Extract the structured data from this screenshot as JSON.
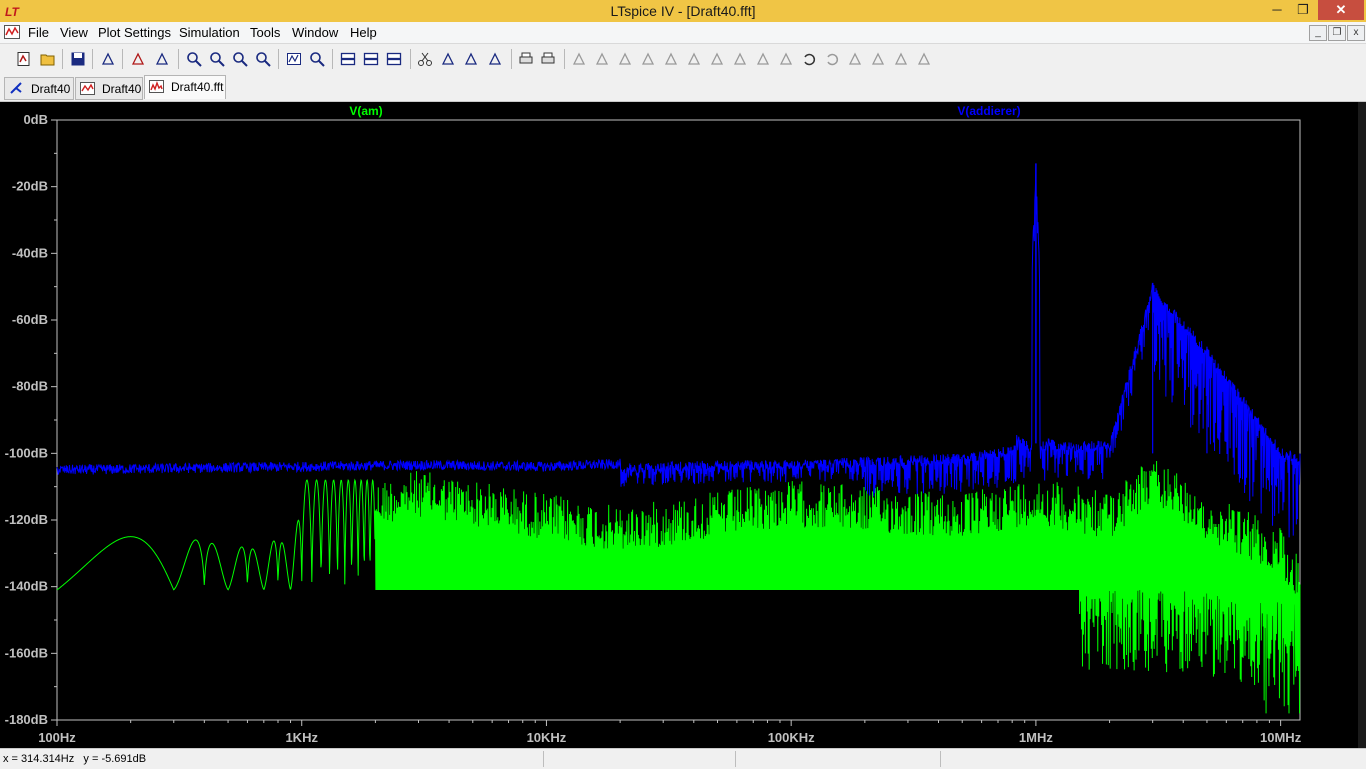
{
  "window": {
    "title": "LTspice IV - [Draft40.fft]",
    "min_glyph": "─",
    "max_glyph": "❐",
    "close_glyph": "✕"
  },
  "menu": {
    "items": [
      "File",
      "View",
      "Plot Settings",
      "Simulation",
      "Tools",
      "Window",
      "Help"
    ],
    "mdi_min_glyph": "_",
    "mdi_restore_glyph": "❐",
    "mdi_close_glyph": "x"
  },
  "toolbar": {
    "icons": [
      "new-schematic-icon",
      "open-icon",
      "save-icon",
      "control-panel-icon",
      "run-icon",
      "pan-icon",
      "zoom-in-icon",
      "zoom-area-icon",
      "zoom-out-icon",
      "zoom-cancel-icon",
      "autorange-icon",
      "zoom-fit-icon",
      "tile-horizontal-icon",
      "cascade-icon",
      "tile-vertical-icon",
      "cut-icon",
      "copy-icon",
      "paste-icon",
      "find-icon",
      "print-setup-icon",
      "print-icon",
      "wire-icon",
      "ground-icon",
      "label-net-icon",
      "resistor-icon",
      "capacitor-icon",
      "inductor-icon",
      "diode-icon",
      "component-icon",
      "move-icon",
      "drag-icon",
      "undo-icon",
      "redo-icon",
      "rotate-icon",
      "mirror-icon",
      "text-icon",
      "spice-directive-icon"
    ]
  },
  "tabs": [
    {
      "label": "Draft40",
      "icon": "schematic-icon",
      "active": false
    },
    {
      "label": "Draft40",
      "icon": "waveform-icon",
      "active": false
    },
    {
      "label": "Draft40.fft",
      "icon": "fft-icon",
      "active": true
    }
  ],
  "status": {
    "text": "x = 314.314Hz   y = -5.691dB"
  },
  "colors": {
    "green_trace": "#00ff00",
    "blue_trace": "#0000ff",
    "axis": "#c0c0c0",
    "background": "#000000"
  },
  "chart_data": {
    "type": "line",
    "title": "",
    "xlabel": "",
    "ylabel": "",
    "x_scale": "log",
    "xlim": [
      100,
      12000000
    ],
    "ylim": [
      -180,
      0
    ],
    "grid": false,
    "legend": "top",
    "x_tick_labels": [
      "100Hz",
      "1KHz",
      "10KHz",
      "100KHz",
      "1MHz",
      "10MHz"
    ],
    "x_tick_values": [
      100,
      1000,
      10000,
      100000,
      1000000,
      10000000
    ],
    "y_tick_labels": [
      "0dB",
      "-20dB",
      "-40dB",
      "-60dB",
      "-80dB",
      "-100dB",
      "-120dB",
      "-140dB",
      "-160dB",
      "-180dB"
    ],
    "y_tick_values": [
      0,
      -20,
      -40,
      -60,
      -80,
      -100,
      -120,
      -140,
      -160,
      -180
    ],
    "series": [
      {
        "name": "V(am)",
        "color": "#00ff00",
        "x": [
          100,
          200,
          300,
          400,
          500,
          600,
          700,
          800,
          900,
          1000,
          2000,
          3000,
          20000,
          100000,
          500000,
          1000000,
          2000000,
          3000000,
          5000000,
          10000000,
          12000000
        ],
        "y": [
          -141,
          -125,
          -140,
          -118,
          -140,
          -121,
          -140,
          -118,
          -140,
          -108,
          -108,
          -105,
          -116,
          -108,
          -112,
          -107,
          -112,
          -101,
          -112,
          -122,
          -132
        ]
      },
      {
        "name": "V(addierer)",
        "color": "#0000ff",
        "x": [
          100,
          300,
          1000,
          3000,
          10000,
          50000,
          100000,
          500000,
          900000,
          1000000,
          1100000,
          2000000,
          3000000,
          5000000,
          10000000,
          12000000
        ],
        "y": [
          -105,
          -104.5,
          -104,
          -103.5,
          -104,
          -102,
          -102,
          -100,
          -97,
          -13,
          -97,
          -96,
          -49,
          -68,
          -98,
          -100
        ]
      }
    ]
  }
}
